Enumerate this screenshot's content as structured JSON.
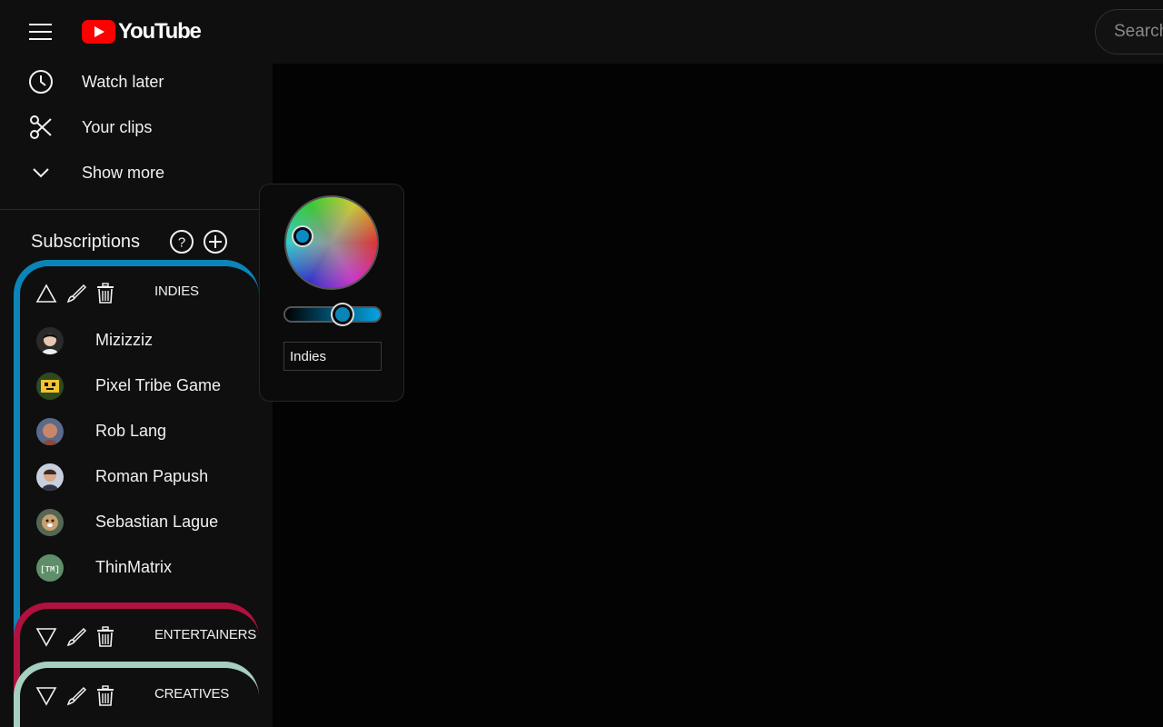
{
  "header": {
    "logo_text": "YouTube",
    "search_placeholder": "Search"
  },
  "sidebar": {
    "nav_items": [
      {
        "label": "Watch later",
        "icon": "clock-icon"
      },
      {
        "label": "Your clips",
        "icon": "scissors-icon"
      },
      {
        "label": "Show more",
        "icon": "chevron-down-icon"
      }
    ],
    "subscriptions_title": "Subscriptions"
  },
  "groups": [
    {
      "name": "INDIES",
      "color": "#0b85b8",
      "expanded": true,
      "channels": [
        {
          "name": "Mizizziz"
        },
        {
          "name": "Pixel Tribe Game"
        },
        {
          "name": "Rob Lang"
        },
        {
          "name": "Roman Papush"
        },
        {
          "name": "Sebastian Lague"
        },
        {
          "name": "ThinMatrix",
          "avatar_text": "[TM]"
        }
      ]
    },
    {
      "name": "ENTERTAINERS",
      "color": "#b0113f",
      "expanded": false
    },
    {
      "name": "CREATIVES",
      "color": "#a5cfc0",
      "expanded": false
    }
  ],
  "color_picker": {
    "group_name_value": "Indies",
    "selected_color": "#0b85b8",
    "brightness": 0.62
  }
}
